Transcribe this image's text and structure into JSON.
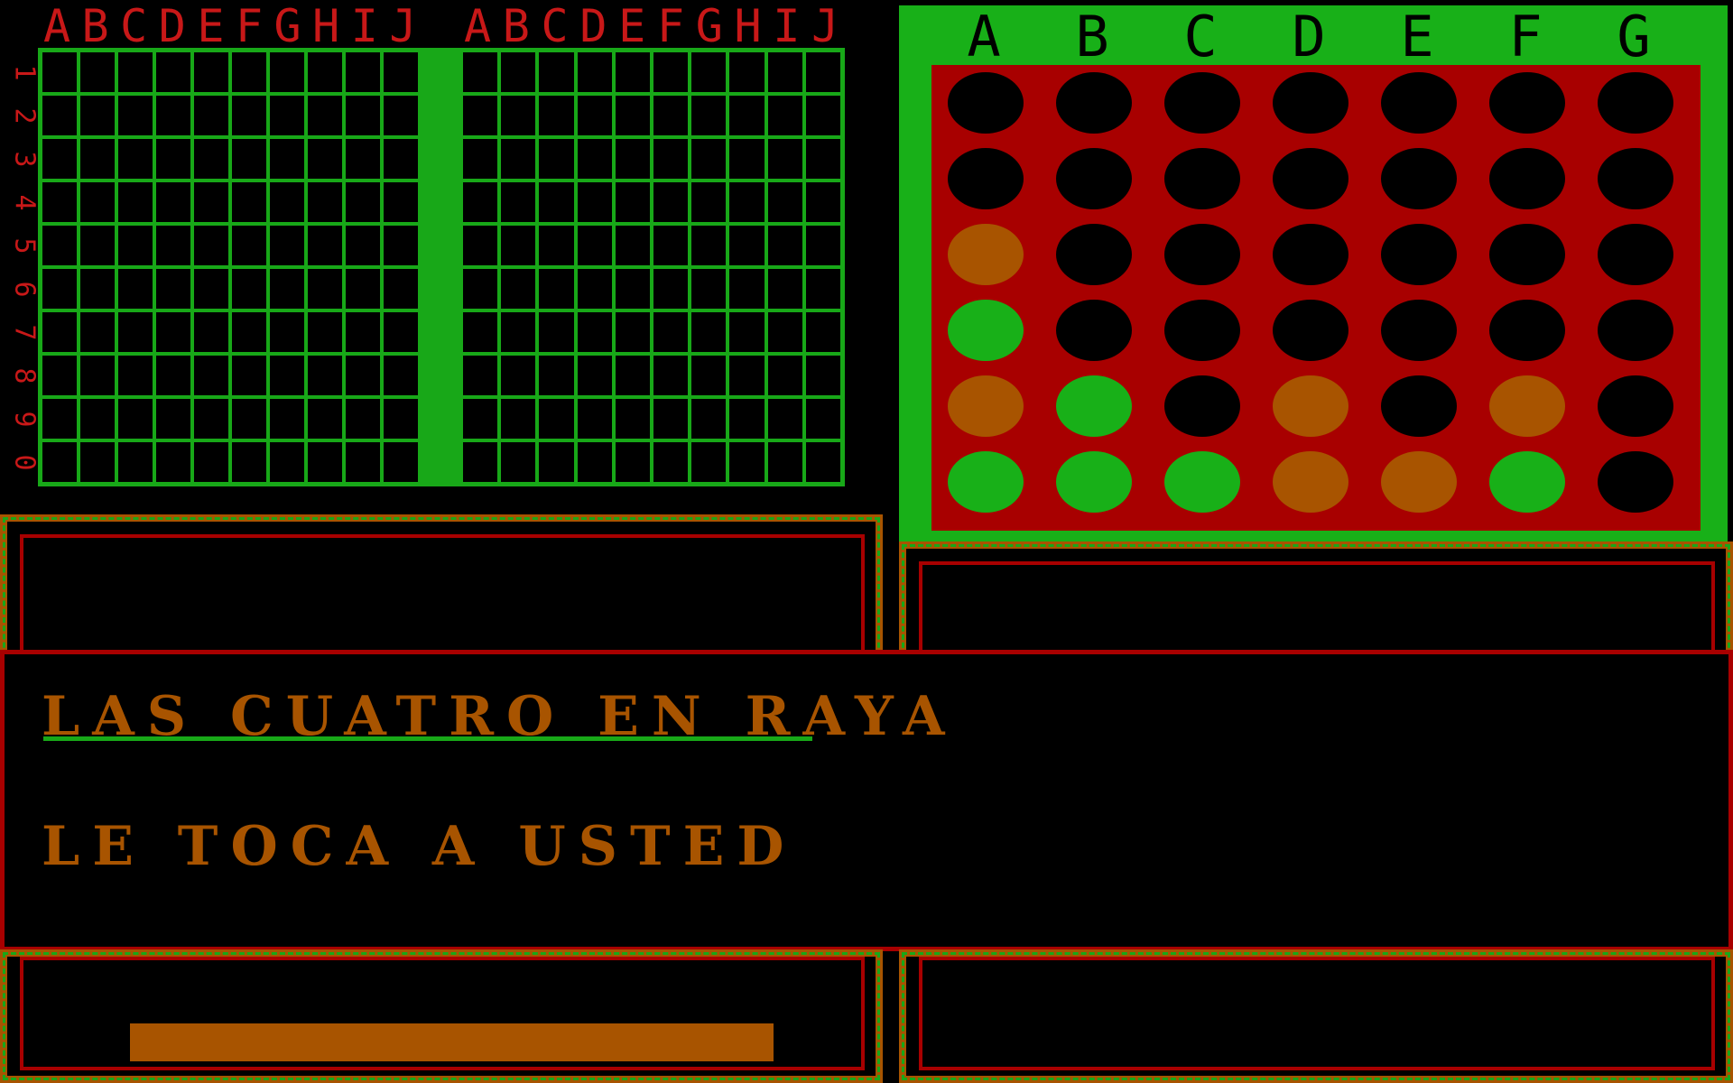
{
  "battleship": {
    "columns": [
      "A",
      "B",
      "C",
      "D",
      "E",
      "F",
      "G",
      "H",
      "I",
      "J"
    ],
    "rows": [
      "1",
      "2",
      "3",
      "4",
      "5",
      "6",
      "7",
      "8",
      "9",
      "0"
    ]
  },
  "connect_four": {
    "columns": [
      "A",
      "B",
      "C",
      "D",
      "E",
      "F",
      "G"
    ],
    "board": [
      [
        "empty",
        "empty",
        "empty",
        "empty",
        "empty",
        "empty",
        "empty"
      ],
      [
        "empty",
        "empty",
        "empty",
        "empty",
        "empty",
        "empty",
        "empty"
      ],
      [
        "orange",
        "empty",
        "empty",
        "empty",
        "empty",
        "empty",
        "empty"
      ],
      [
        "green",
        "empty",
        "empty",
        "empty",
        "empty",
        "empty",
        "empty"
      ],
      [
        "orange",
        "green",
        "empty",
        "orange",
        "empty",
        "orange",
        "empty"
      ],
      [
        "green",
        "green",
        "green",
        "orange",
        "orange",
        "green",
        "empty"
      ]
    ]
  },
  "colors": {
    "red": "#a80000",
    "bright_red": "#c81818",
    "green": "#18b018",
    "orange": "#a85400"
  },
  "messages": {
    "title": "LAS CUATRO EN RAYA",
    "status": "LE TOCA A USTED"
  },
  "progress": {
    "fraction": 0.88
  }
}
